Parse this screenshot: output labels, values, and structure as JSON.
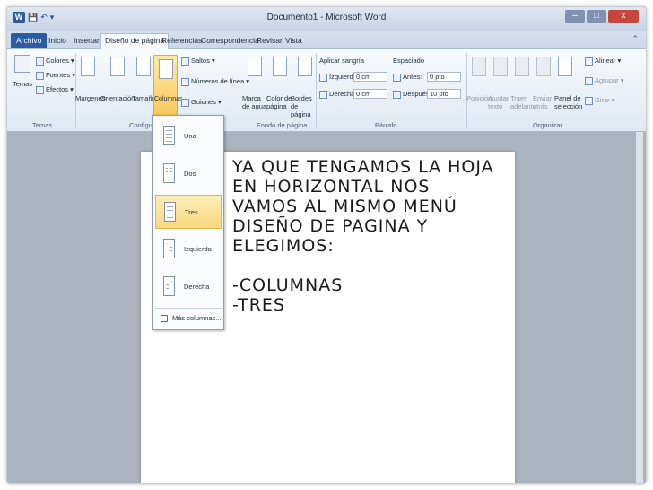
{
  "window": {
    "title": "Documento1 - Microsoft Word",
    "qat_items": [
      "W",
      "💾",
      "↶",
      "▾"
    ],
    "controls": [
      "–",
      "□",
      "x"
    ]
  },
  "tabs": [
    "Archivo",
    "Inicio",
    "Insertar",
    "Diseño de página",
    "Referencias",
    "Correspondencia",
    "Revisar",
    "Vista"
  ],
  "active_tab": "Diseño de página",
  "ribbon": {
    "temas": {
      "button": "Temas",
      "colores": "Colores",
      "fuentes": "Fuentes",
      "efectos": "Efectos",
      "group": "Temas"
    },
    "configurar": {
      "margenes": "Márgenes",
      "orientacion": "Orientación",
      "tamano": "Tamaño",
      "columnas": "Columnas",
      "saltos": "Saltos",
      "numeros_linea": "Números de línea",
      "guiones": "Guiones",
      "group": "Configurar página"
    },
    "fondo": {
      "marca_agua": "Marca de agua",
      "color_pagina": "Color de página",
      "bordes_pagina": "Bordes de página",
      "group": "Fondo de página"
    },
    "parrafo": {
      "aplicar_sangria": "Aplicar sangría",
      "izquierda_label": "Izquierda:",
      "izquierda_value": "0 cm",
      "derecha_label": "Derecha:",
      "derecha_value": "0 cm",
      "espaciado": "Espaciado",
      "antes_label": "Antes:",
      "antes_value": "0 pto",
      "despues_label": "Después:",
      "despues_value": "10 pto",
      "group": "Párrafo"
    },
    "organizar": {
      "posicion": "Posición",
      "ajustar_texto": "Ajustar texto",
      "traer_adelante": "Traer adelante",
      "enviar_atras": "Enviar atrás",
      "panel_seleccion": "Panel de selección",
      "alinear": "Alinear",
      "agrupar": "Agrupar",
      "girar": "Girar",
      "group": "Organizar"
    }
  },
  "columns_menu": {
    "items": [
      "Una",
      "Dos",
      "Tres",
      "Izquierda",
      "Derecha"
    ],
    "selected": "Tres",
    "more": "Más columnas..."
  },
  "document": {
    "text": "Ya que tengamos la hoja en horizontal nos vamos al mismo menú diseño de pagina y elegimos:\n\n-Columnas\n-Tres"
  }
}
